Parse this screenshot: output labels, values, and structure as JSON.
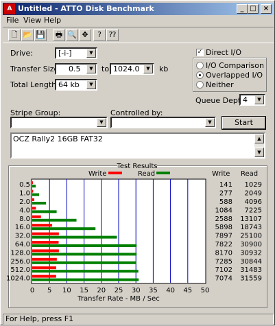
{
  "window": {
    "title": "Untitled - ATTO Disk Benchmark",
    "app_icon": "disk-icon"
  },
  "title_buttons": {
    "minimize": "_",
    "maximize": "□",
    "close": "×"
  },
  "menu": [
    "File",
    "View",
    "Help"
  ],
  "toolbar": [
    {
      "icon": "new-file-icon",
      "glyph": "🗋"
    },
    {
      "icon": "open-folder-icon",
      "glyph": "📂"
    },
    {
      "icon": "save-icon",
      "glyph": "💾"
    },
    {
      "icon": "print-icon",
      "glyph": "🖶"
    },
    {
      "icon": "print-preview-icon",
      "glyph": "🔍"
    },
    {
      "icon": "move-icon",
      "glyph": "✥"
    },
    {
      "icon": "help-icon",
      "glyph": "?"
    },
    {
      "icon": "context-help-icon",
      "glyph": "⁇"
    }
  ],
  "form": {
    "drive_label": "Drive:",
    "drive_value": "[-i-]",
    "transfer_size_label": "Transfer Size:",
    "transfer_from": "0.5",
    "to_label": "to",
    "transfer_to": "1024.0",
    "kb_label": "kb",
    "total_length_label": "Total Length:",
    "total_length_value": "64 kb",
    "direct_io_label": "Direct I/O",
    "direct_io_checked": true,
    "io_comparison_label": "I/O Comparison",
    "overlapped_io_label": "Overlapped I/O",
    "neither_label": "Neither",
    "selected_mode": "Overlapped I/O",
    "queue_depth_label": "Queue Depth:",
    "queue_depth_value": "4",
    "stripe_group_label": "Stripe Group:",
    "stripe_group_value": "",
    "controlled_by_label": "Controlled by:",
    "controlled_by_value": "",
    "start_button": "Start",
    "description": "OCZ Rally2 16GB FAT32"
  },
  "results": {
    "group_title": "Test Results",
    "write_legend": "Write",
    "read_legend": "Read",
    "write_header": "Write",
    "read_header": "Read",
    "write_color": "#ff0000",
    "read_color": "#008000",
    "gridline_color": "#0000c0"
  },
  "chart_data": {
    "type": "bar",
    "orientation": "horizontal",
    "categories": [
      "0.5",
      "1.0",
      "2.0",
      "4.0",
      "8.0",
      "16.0",
      "32.0",
      "64.0",
      "128.0",
      "256.0",
      "512.0",
      "1024.0"
    ],
    "series": [
      {
        "name": "Write",
        "values": [
          0.14,
          0.27,
          0.57,
          1.06,
          2.53,
          5.76,
          7.71,
          7.64,
          7.71,
          7.11,
          6.94,
          6.91
        ]
      },
      {
        "name": "Read",
        "values": [
          1.0,
          2.0,
          4.0,
          7.06,
          12.8,
          18.3,
          24.5,
          30.2,
          30.2,
          30.1,
          30.7,
          30.8
        ]
      }
    ],
    "write_values_kb": [
      141,
      277,
      588,
      1084,
      2588,
      5898,
      7897,
      7822,
      8170,
      7285,
      7102,
      7074
    ],
    "read_values_kb": [
      1029,
      2049,
      4096,
      7225,
      13107,
      18743,
      25100,
      30900,
      30932,
      30844,
      31483,
      31559
    ],
    "x_ticks": [
      "0",
      "5",
      "10",
      "15",
      "20",
      "25",
      "30",
      "35",
      "40",
      "45",
      "50"
    ],
    "xlim": [
      0,
      50
    ],
    "xlabel": "Transfer Rate - MB / Sec",
    "ylabel": "",
    "grid": true,
    "legend": "top"
  },
  "status": {
    "text": "For Help, press F1"
  }
}
